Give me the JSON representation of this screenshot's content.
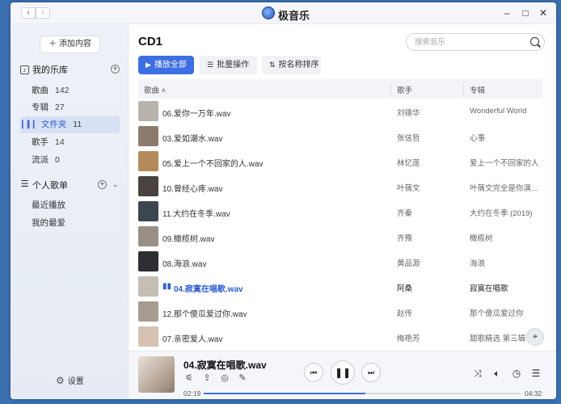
{
  "app": {
    "title": "极音乐"
  },
  "titlebar": {
    "back": "‹",
    "forward": "›",
    "minimize": "–",
    "maximize": "□",
    "close": "✕"
  },
  "sidebar": {
    "import_label": "＋ 添加内容",
    "library": {
      "title": "我的乐库",
      "items": [
        {
          "label": "歌曲",
          "count": "142"
        },
        {
          "label": "专辑",
          "count": "27"
        },
        {
          "label": "文件夹",
          "count": "11"
        },
        {
          "label": "歌手",
          "count": "14"
        },
        {
          "label": "流派",
          "count": "0"
        }
      ]
    },
    "playlists": {
      "title": "个人歌单",
      "items": [
        {
          "label": "最近播放"
        },
        {
          "label": "我的最爱"
        }
      ]
    },
    "settings_label": "设置"
  },
  "main": {
    "title": "CD1",
    "search_placeholder": "搜索音乐",
    "toolbar": {
      "play_all": "播放全部",
      "batch": "批量操作",
      "sort": "按名称排序"
    },
    "columns": {
      "song": "歌曲",
      "artist": "歌手",
      "album": "专辑"
    },
    "rows": [
      {
        "name": "06.爱你一万年.wav",
        "artist": "刘德华",
        "album": "Wonderful World",
        "cover": "#b9b3ae",
        "playing": false
      },
      {
        "name": "03.爱如潮水.wav",
        "artist": "张信哲",
        "album": "心事",
        "cover": "#8c7b6c",
        "playing": false
      },
      {
        "name": "05.爱上一个不回家的人.wav",
        "artist": "林忆莲",
        "album": "爱上一个不回家的人",
        "cover": "#b58a5a",
        "playing": false
      },
      {
        "name": "10.曾经心疼.wav",
        "artist": "叶蒨文",
        "album": "叶蒨文完全是你演唱会",
        "cover": "#4a4240",
        "playing": false
      },
      {
        "name": "11.大约在冬季.wav",
        "artist": "齐秦",
        "album": "大约在冬季 (2019)",
        "cover": "#3c4650",
        "playing": false
      },
      {
        "name": "09.橄榄树.wav",
        "artist": "齐豫",
        "album": "橄榄树",
        "cover": "#9a8f84",
        "playing": false
      },
      {
        "name": "08.海浪.wav",
        "artist": "黄品源",
        "album": "海浪",
        "cover": "#2e2f33",
        "playing": false
      },
      {
        "name": "04.寂寞在唱歌.wav",
        "artist": "阿桑",
        "album": "寂寞在唱歌",
        "cover": "#c6bdb4",
        "playing": true
      },
      {
        "name": "12.那个傻瓜爱过你.wav",
        "artist": "赵传",
        "album": "那个傻瓜爱过你",
        "cover": "#a89c90",
        "playing": false
      },
      {
        "name": "07.亲密爱人.wav",
        "artist": "梅艳芳",
        "album": "甜歌精选 第三辑",
        "cover": "#d6c2b0",
        "playing": false
      }
    ]
  },
  "player": {
    "title": "04.寂寞在唱歌.wav",
    "current_time": "02:19",
    "total_time": "04:32",
    "progress": 0.51
  },
  "colors": {
    "accent": "#3d6fe4",
    "desktop": "#3a6fb0"
  }
}
